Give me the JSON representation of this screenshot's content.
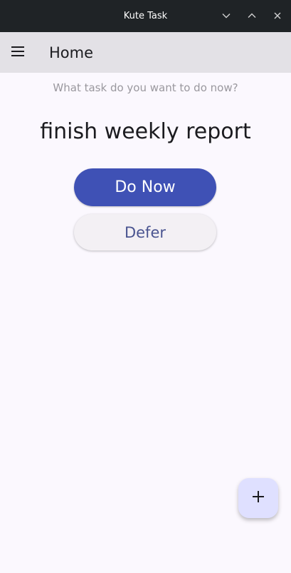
{
  "window": {
    "title": "Kute Task",
    "controls": [
      "chevron-down-icon",
      "chevron-up-icon",
      "close-icon"
    ]
  },
  "appbar": {
    "menu_icon": "hamburger-menu-icon",
    "title": "Home"
  },
  "main": {
    "prompt": "What task do you want to do now?",
    "task_name": "finish weekly report",
    "do_now_label": "Do Now",
    "defer_label": "Defer"
  },
  "fab": {
    "icon": "plus-icon"
  },
  "colors": {
    "titlebar_bg": "#1f2326",
    "appbar_bg": "#e3e1e6",
    "background": "#fbf8fe",
    "primary": "#3f51b5",
    "secondary_bg": "#f3f0f4",
    "secondary_text": "#4a5490",
    "fab_bg": "#dfe0ff"
  }
}
